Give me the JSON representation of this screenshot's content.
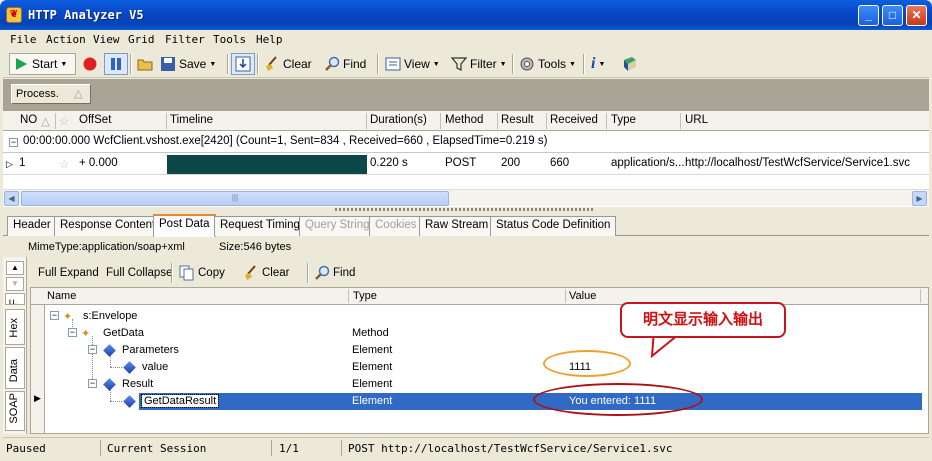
{
  "window": {
    "title": "HTTP Analyzer V5",
    "icon": "app-icon"
  },
  "menu": [
    "File",
    "Action",
    "View",
    "Grid",
    "Filter",
    "Tools",
    "Help"
  ],
  "toolbar": {
    "start": "Start",
    "save": "Save",
    "clear": "Clear",
    "find": "Find",
    "view": "View",
    "filter": "Filter",
    "tools": "Tools"
  },
  "group_header": "Process.",
  "grid": {
    "columns": [
      "NO",
      "OffSet",
      "Timeline",
      "Duration(s)",
      "Method",
      "Result",
      "Received",
      "Type",
      "URL"
    ],
    "group_row": "00:00:00.000   WcfClient.vshost.exe[2420]  (Count=1, Sent=834 , Received=660 , ElapsedTime=0.219 s)",
    "rows": [
      {
        "no": "1",
        "offset": "+ 0.000",
        "duration": "0.220 s",
        "method": "POST",
        "result": "200",
        "received": "660",
        "type": "application/s...",
        "url": "http://localhost/TestWcfService/Service1.svc"
      }
    ]
  },
  "tabs": [
    "Header",
    "Response Content",
    "Post Data",
    "Request Timing",
    "Query String",
    "Cookies",
    "Raw Stream",
    "Status Code Definition"
  ],
  "active_tab": "Post Data",
  "info": {
    "mimetype": "MimeType:application/soap+xml",
    "size": "Size:546 bytes"
  },
  "side_tabs": [
    "SOAP",
    "Data",
    "Hex",
    "F"
  ],
  "subtoolbar": {
    "full_expand": "Full Expand",
    "full_collapse": "Full Collapse",
    "copy": "Copy",
    "clear": "Clear",
    "find": "Find"
  },
  "tree": {
    "columns": [
      "Name",
      "Type",
      "Value"
    ],
    "rows": [
      {
        "name": "s:Envelope",
        "type": "",
        "value": ""
      },
      {
        "name": "GetData",
        "type": "Method",
        "value": ""
      },
      {
        "name": "Parameters",
        "type": "Element",
        "value": ""
      },
      {
        "name": "value",
        "type": "Element",
        "value": "1111"
      },
      {
        "name": "Result",
        "type": "Element",
        "value": ""
      },
      {
        "name": "GetDataResult",
        "type": "Element",
        "value": "You entered: 1111"
      }
    ]
  },
  "annotation": "明文显示输入输出",
  "status": {
    "state": "Paused",
    "session": "Current Session",
    "page": "1/1",
    "request": "POST  http://localhost/TestWcfService/Service1.svc"
  }
}
